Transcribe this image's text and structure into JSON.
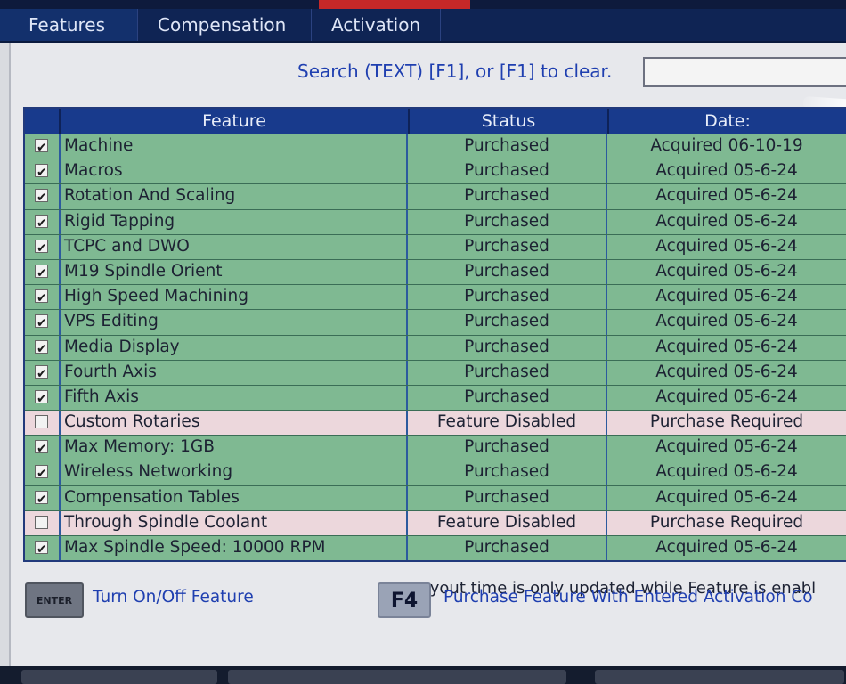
{
  "tabs": [
    {
      "label": "Features"
    },
    {
      "label": "Compensation"
    },
    {
      "label": "Activation"
    }
  ],
  "search": {
    "label": "Search (TEXT) [F1], or [F1] to clear.",
    "value": ""
  },
  "table": {
    "headers": [
      "Feature",
      "Status",
      "Date:"
    ],
    "rows": [
      {
        "checked": true,
        "feature": "Machine",
        "status": "Purchased",
        "date": "Acquired 06-10-19"
      },
      {
        "checked": true,
        "feature": "Macros",
        "status": "Purchased",
        "date": "Acquired 05-6-24"
      },
      {
        "checked": true,
        "feature": "Rotation And Scaling",
        "status": "Purchased",
        "date": "Acquired 05-6-24"
      },
      {
        "checked": true,
        "feature": "Rigid Tapping",
        "status": "Purchased",
        "date": "Acquired 05-6-24"
      },
      {
        "checked": true,
        "feature": "TCPC and DWO",
        "status": "Purchased",
        "date": "Acquired 05-6-24"
      },
      {
        "checked": true,
        "feature": "M19 Spindle Orient",
        "status": "Purchased",
        "date": "Acquired 05-6-24"
      },
      {
        "checked": true,
        "feature": "High Speed Machining",
        "status": "Purchased",
        "date": "Acquired 05-6-24"
      },
      {
        "checked": true,
        "feature": "VPS Editing",
        "status": "Purchased",
        "date": "Acquired 05-6-24"
      },
      {
        "checked": true,
        "feature": "Media Display",
        "status": "Purchased",
        "date": "Acquired 05-6-24"
      },
      {
        "checked": true,
        "feature": "Fourth Axis",
        "status": "Purchased",
        "date": "Acquired 05-6-24"
      },
      {
        "checked": true,
        "feature": "Fifth Axis",
        "status": "Purchased",
        "date": "Acquired 05-6-24"
      },
      {
        "checked": false,
        "feature": "Custom Rotaries",
        "status": "Feature Disabled",
        "date": "Purchase Required"
      },
      {
        "checked": true,
        "feature": "Max Memory: 1GB",
        "status": "Purchased",
        "date": "Acquired 05-6-24"
      },
      {
        "checked": true,
        "feature": "Wireless Networking",
        "status": "Purchased",
        "date": "Acquired 05-6-24"
      },
      {
        "checked": true,
        "feature": "Compensation Tables",
        "status": "Purchased",
        "date": "Acquired 05-6-24"
      },
      {
        "checked": false,
        "feature": "Through Spindle Coolant",
        "status": "Feature Disabled",
        "date": "Purchase Required"
      },
      {
        "checked": true,
        "feature": "Max Spindle Speed: 10000 RPM",
        "status": "Purchased",
        "date": "Acquired 05-6-24"
      }
    ]
  },
  "footnote": "*Tryout time is only updated while Feature is enabl",
  "keys": {
    "enter_label": "ENTER",
    "enter_hint": "Turn On/Off Feature",
    "f4_label": "F4",
    "f4_hint": "Purchase Feature With Entered Activation Co"
  },
  "colors": {
    "purchased_row": "#7fb992",
    "disabled_row": "#ecd7dc",
    "header": "#183a8c",
    "accent_text": "#1f3fb0"
  }
}
